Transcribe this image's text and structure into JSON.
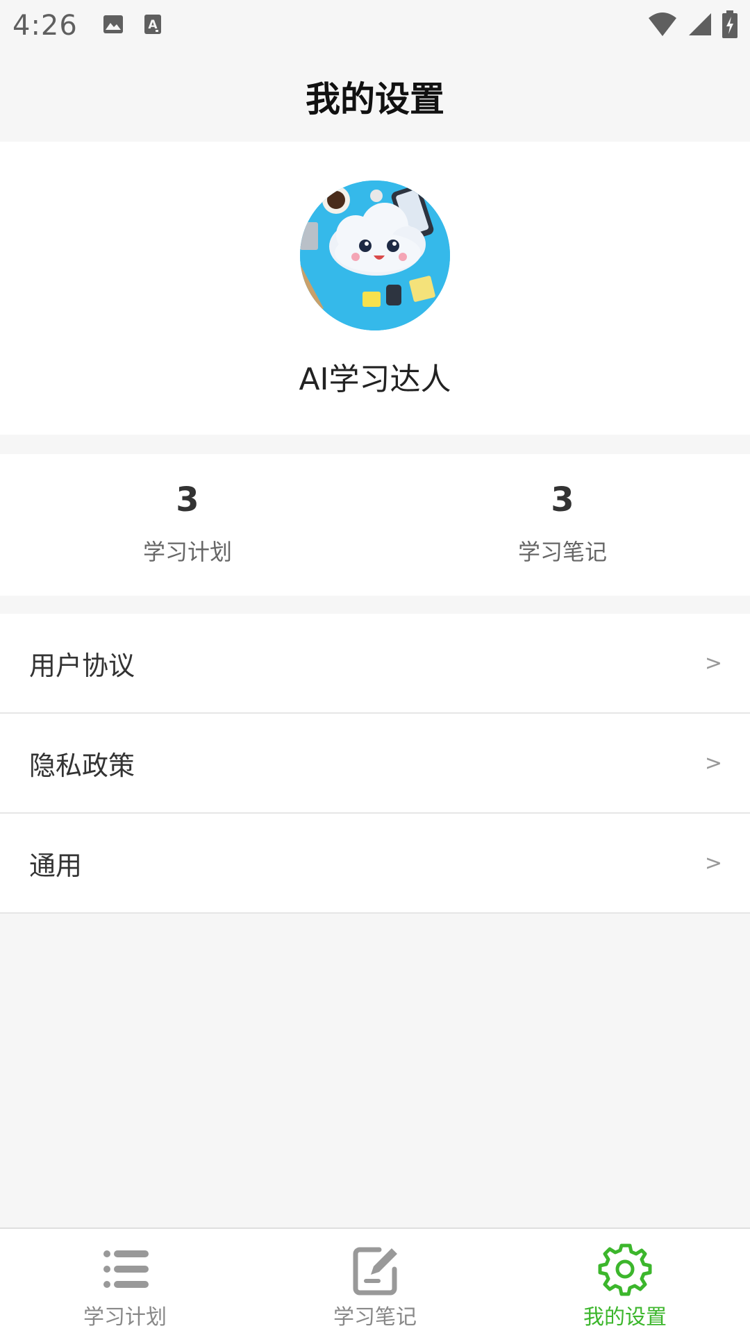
{
  "status_bar": {
    "time": "4:26",
    "left_icons": [
      "image-icon",
      "font-icon"
    ],
    "right_icons": [
      "wifi-icon",
      "signal-icon",
      "battery-charging-icon"
    ]
  },
  "header": {
    "title": "我的设置"
  },
  "profile": {
    "username": "AI学习达人",
    "avatar_icon": "cloud-mascot-avatar"
  },
  "stats": [
    {
      "value": "3",
      "label": "学习计划"
    },
    {
      "value": "3",
      "label": "学习笔记"
    }
  ],
  "menu": [
    {
      "label": "用户协议",
      "arrow": ">"
    },
    {
      "label": "隐私政策",
      "arrow": ">"
    },
    {
      "label": "通用",
      "arrow": ">"
    }
  ],
  "tabs": [
    {
      "label": "学习计划",
      "icon": "list-icon",
      "active": false
    },
    {
      "label": "学习笔记",
      "icon": "edit-note-icon",
      "active": false
    },
    {
      "label": "我的设置",
      "icon": "gear-icon",
      "active": true
    }
  ],
  "colors": {
    "accent": "#3cb62c",
    "inactive": "#888888",
    "background": "#f6f6f6"
  }
}
